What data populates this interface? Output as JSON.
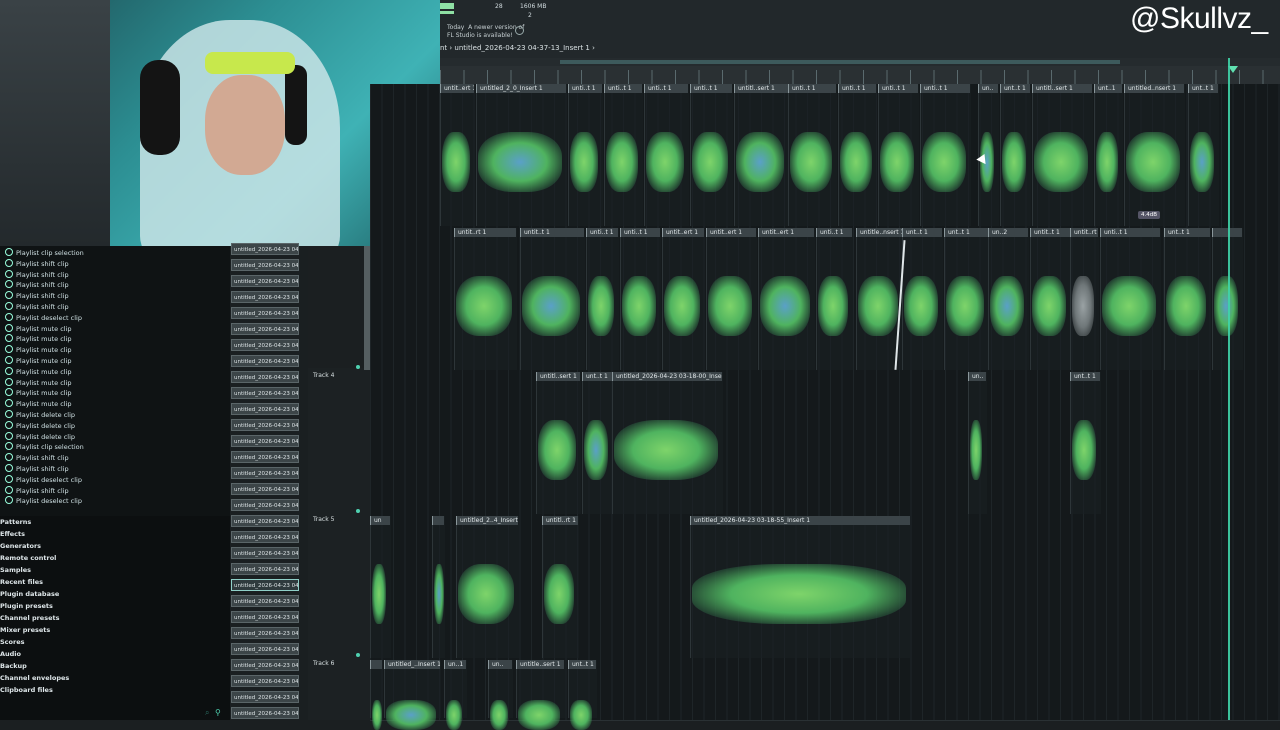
{
  "overlay": {
    "handle": "@Skullvz_"
  },
  "topbar": {
    "cpu": "28",
    "memory": "1606 MB",
    "polyphony": "2",
    "update_hint": "Today  A newer version of\nFL Studio is available!",
    "breadcrumb": "nt › untitled_2026-04-23 04-37-13_Insert 1 ›"
  },
  "history": [
    "Playlist clip selection",
    "Playlist shift clip",
    "Playlist shift clip",
    "Playlist shift clip",
    "Playlist shift clip",
    "Playlist shift clip",
    "Playlist deselect clip",
    "Playlist mute clip",
    "Playlist mute clip",
    "Playlist mute clip",
    "Playlist mute clip",
    "Playlist mute clip",
    "Playlist mute clip",
    "Playlist mute clip",
    "Playlist mute clip",
    "Playlist delete clip",
    "Playlist delete clip",
    "Playlist delete clip",
    "Playlist clip selection",
    "Playlist shift clip",
    "Playlist shift clip",
    "Playlist deselect clip",
    "Playlist shift clip",
    "Playlist deselect clip"
  ],
  "browser": [
    "Patterns",
    "Effects",
    "Generators",
    "Remote control",
    "Samples",
    "Recent files",
    "Plugin database",
    "Plugin presets",
    "Channel presets",
    "Mixer presets",
    "Scores",
    "Audio",
    "Backup",
    "Channel envelopes",
    "Clipboard files"
  ],
  "files": {
    "label": "untitled_2026-04-23 04-",
    "count": 30,
    "selected_index": 21
  },
  "tracks": [
    {
      "name": "Track 4"
    },
    {
      "name": "Track 5"
    },
    {
      "name": "Track 6"
    }
  ],
  "clips": {
    "lane1": [
      "untit..ert 1",
      "untitled_2_0_Insert 1",
      "unti..t 1",
      "unti..t 1",
      "unti..t 1",
      "unti..t 1",
      "untitl..sert 1",
      "unti..t 1",
      "unti..t 1",
      "unti..t 1",
      "unti..t 1",
      "un..",
      "unt..t 1",
      "untitl..sert 1",
      "unt..1",
      "untitled..nsert 1",
      "unt..t 1"
    ],
    "lane2": [
      "untit..rt 1",
      "untit..t 1",
      "unti..t 1",
      "unti..t 1",
      "untit..ert 1",
      "untit..ert 1",
      "untit..ert 1",
      "unti..t 1",
      "untitle..nsert 1",
      "unt..t 1",
      "unt..t 1",
      "un..2",
      "untit..t 1",
      "untit..rt 1",
      "unti..t 1",
      "unt..t 1"
    ],
    "lane3": [
      "untitl..sert 1",
      "unt..t 1",
      "untitled_2026-04-23 03-18-00_Insert 1",
      "un..",
      "unt..t 1"
    ],
    "lane4": [
      "un",
      "",
      "untitled_2..4_Insert 1",
      "untitl..rt 1",
      "untitled_2026-04-23 03-18-55_Insert 1"
    ],
    "lane5": [
      "",
      "untitled_..Insert 1",
      "un..1",
      "un..",
      "untitle..sert 1",
      "unt..t 1"
    ]
  },
  "tooltip": "4.4dB",
  "colors": {
    "accent": "#3fd4a8",
    "waveform": "#5bc46a",
    "clip_header": "#3b4448"
  }
}
